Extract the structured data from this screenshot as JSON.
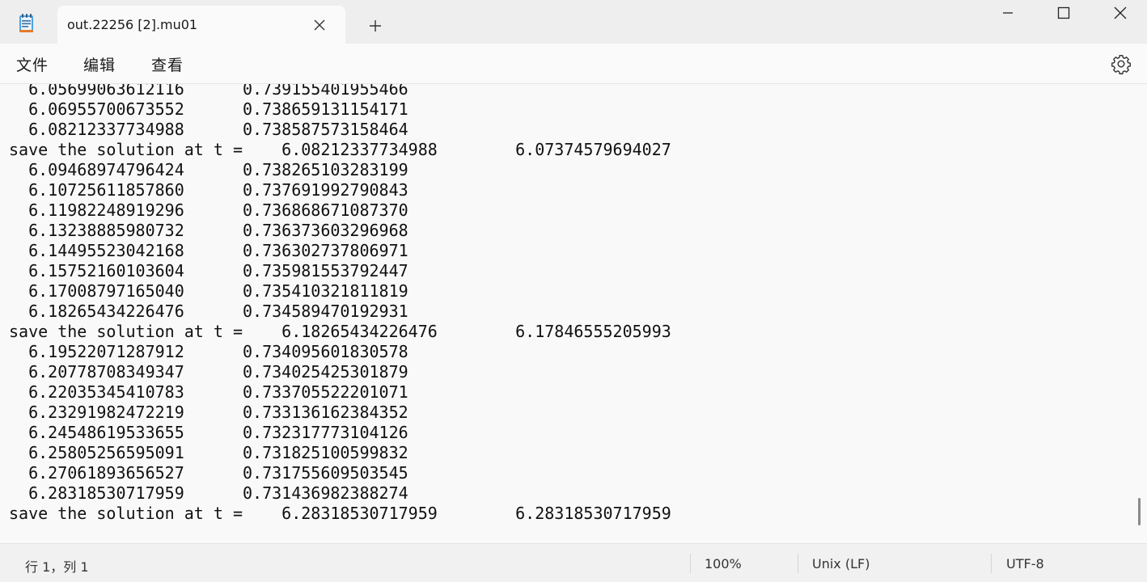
{
  "tab": {
    "title": "out.22256 [2].mu01",
    "icon": "notepad-icon"
  },
  "window_controls": {
    "minimize_icon": "minimize-icon",
    "maximize_icon": "maximize-icon",
    "close_icon": "close-icon"
  },
  "menu": {
    "file": "文件",
    "edit": "编辑",
    "view": "查看"
  },
  "editor": {
    "lines": [
      "  6.05699063612116      0.739155401955466",
      "  6.06955700673552      0.738659131154171",
      "  6.08212337734988      0.738587573158464",
      "save the solution at t =    6.08212337734988        6.07374579694027",
      "  6.09468974796424      0.738265103283199",
      "  6.10725611857860      0.737691992790843",
      "  6.11982248919296      0.736868671087370",
      "  6.13238885980732      0.736373603296968",
      "  6.14495523042168      0.736302737806971",
      "  6.15752160103604      0.735981553792447",
      "  6.17008797165040      0.735410321811819",
      "  6.18265434226476      0.734589470192931",
      "save the solution at t =    6.18265434226476        6.17846555205993",
      "  6.19522071287912      0.734095601830578",
      "  6.20778708349347      0.734025425301879",
      "  6.22035345410783      0.733705522201071",
      "  6.23291982472219      0.733136162384352",
      "  6.24548619533655      0.732317773104126",
      "  6.25805256595091      0.731825100599832",
      "  6.27061893656527      0.731755609503545",
      "  6.28318530717959      0.731436982388274",
      "save the solution at t =    6.28318530717959        6.28318530717959"
    ]
  },
  "status": {
    "position": "行 1，列 1",
    "zoom": "100%",
    "line_ending": "Unix (LF)",
    "encoding": "UTF-8"
  }
}
